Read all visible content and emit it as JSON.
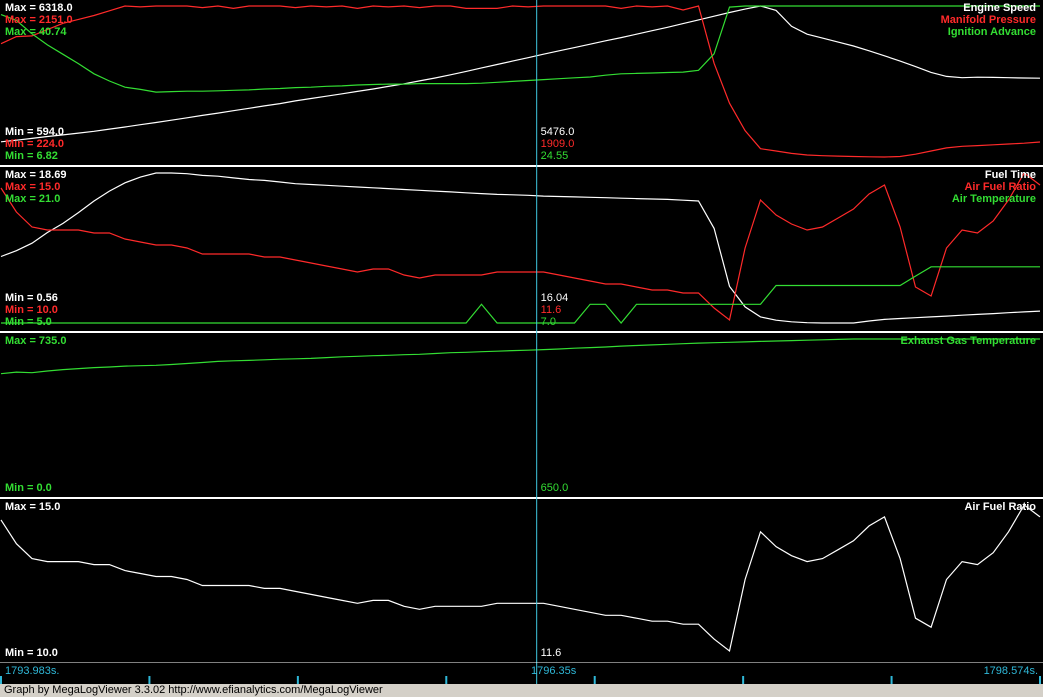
{
  "colors": {
    "white": "#ffffff",
    "red": "#ff2a2a",
    "green": "#33dd33",
    "cursor": "#3fc8e0",
    "timeaxis": "#2fb8d8"
  },
  "cursor_time": "1796.35s",
  "time_start_label": "1793.983s.",
  "time_end_label": "1798.574s.",
  "footer_text": "Graph by MegaLogViewer 3.3.02 http://www.efianalytics.com/MegaLogViewer",
  "panels": [
    {
      "traces": [
        {
          "name": "Engine Speed",
          "color": "white",
          "max_label": "Max = 6318.0",
          "min_label": "Min = 594.0",
          "cursor_value": "5476.0"
        },
        {
          "name": "Manifold Pressure",
          "color": "red",
          "max_label": "Max = 2151.0",
          "min_label": "Min = 224.0",
          "cursor_value": "1909.0"
        },
        {
          "name": "Ignition Advance",
          "color": "green",
          "max_label": "Max = 40.74",
          "min_label": "Min = 6.82",
          "cursor_value": "24.55"
        }
      ]
    },
    {
      "traces": [
        {
          "name": "Fuel Time",
          "color": "white",
          "max_label": "Max = 18.69",
          "min_label": "Min = 0.56",
          "cursor_value": "16.04"
        },
        {
          "name": "Air Fuel Ratio",
          "color": "red",
          "max_label": "Max = 15.0",
          "min_label": "Min = 10.0",
          "cursor_value": "11.6"
        },
        {
          "name": "Air Temperature",
          "color": "green",
          "max_label": "Max = 21.0",
          "min_label": "Min = 5.0",
          "cursor_value": "7.0"
        }
      ]
    },
    {
      "traces": [
        {
          "name": "Exhaust Gas Temperature",
          "color": "green",
          "max_label": "Max = 735.0",
          "min_label": "Min = 0.0",
          "cursor_value": "650.0"
        }
      ]
    },
    {
      "traces": [
        {
          "name": "Air Fuel Ratio",
          "color": "white",
          "max_label": "Max = 15.0",
          "min_label": "Min = 10.0",
          "cursor_value": "11.6"
        }
      ]
    }
  ],
  "chart_data": {
    "type": "line",
    "x_unit": "s",
    "x_range": [
      1793.983,
      1798.574
    ],
    "cursor_x": 1796.35,
    "x": [
      1793.983,
      1794.051,
      1794.12,
      1794.188,
      1794.257,
      1794.325,
      1794.394,
      1794.462,
      1794.531,
      1794.599,
      1794.668,
      1794.736,
      1794.805,
      1794.873,
      1794.942,
      1795.01,
      1795.079,
      1795.147,
      1795.216,
      1795.284,
      1795.353,
      1795.421,
      1795.49,
      1795.558,
      1795.627,
      1795.695,
      1795.764,
      1795.832,
      1795.901,
      1795.969,
      1796.038,
      1796.106,
      1796.175,
      1796.243,
      1796.312,
      1796.38,
      1796.449,
      1796.517,
      1796.586,
      1796.654,
      1796.723,
      1796.791,
      1796.86,
      1796.928,
      1796.997,
      1797.065,
      1797.134,
      1797.202,
      1797.271,
      1797.339,
      1797.408,
      1797.476,
      1797.545,
      1797.613,
      1797.682,
      1797.75,
      1797.819,
      1797.887,
      1797.956,
      1798.024,
      1798.093,
      1798.161,
      1798.23,
      1798.298,
      1798.367,
      1798.435,
      1798.504,
      1798.574
    ],
    "series": [
      {
        "name": "Engine Speed",
        "panel": 0,
        "range": [
          594.0,
          6318.0
        ],
        "values": [
          1170,
          1230,
          1300,
          1370,
          1430,
          1500,
          1570,
          1650,
          1730,
          1820,
          1900,
          1990,
          2080,
          2170,
          2260,
          2350,
          2440,
          2530,
          2620,
          2720,
          2810,
          2900,
          2990,
          3080,
          3170,
          3270,
          3370,
          3480,
          3590,
          3710,
          3840,
          3970,
          4100,
          4230,
          4360,
          4490,
          4620,
          4740,
          4870,
          5000,
          5120,
          5250,
          5380,
          5510,
          5650,
          5790,
          5930,
          6070,
          6200,
          6318,
          6150,
          5550,
          5250,
          5100,
          4950,
          4800,
          4620,
          4430,
          4230,
          4020,
          3800,
          3650,
          3600,
          3620,
          3610,
          3600,
          3590,
          3580
        ]
      },
      {
        "name": "Manifold Pressure",
        "panel": 0,
        "range": [
          224.0,
          2151.0
        ],
        "values": [
          1670,
          1760,
          1770,
          1850,
          1930,
          1980,
          2030,
          2090,
          2151,
          2140,
          2151,
          2151,
          2151,
          2130,
          2151,
          2120,
          2151,
          2151,
          2151,
          2130,
          2151,
          2140,
          2151,
          2120,
          2151,
          2140,
          2151,
          2130,
          2151,
          2151,
          2120,
          2120,
          2120,
          2151,
          2140,
          2151,
          2151,
          2151,
          2151,
          2151,
          2120,
          2151,
          2140,
          2151,
          2100,
          2151,
          1420,
          910,
          560,
          330,
          300,
          270,
          250,
          240,
          235,
          230,
          226,
          224,
          230,
          260,
          300,
          340,
          360,
          370,
          380,
          390,
          400,
          415
        ]
      },
      {
        "name": "Ignition Advance",
        "panel": 0,
        "range": [
          6.82,
          40.74
        ],
        "values": [
          38.8,
          37.5,
          34.5,
          32.0,
          29.9,
          27.8,
          25.5,
          23.9,
          22.5,
          22.0,
          21.4,
          21.5,
          21.6,
          21.6,
          21.7,
          21.8,
          21.9,
          22.1,
          22.2,
          22.4,
          22.5,
          22.7,
          22.8,
          23.0,
          23.1,
          23.2,
          23.2,
          23.3,
          23.3,
          23.3,
          23.3,
          23.4,
          23.6,
          23.8,
          24.0,
          24.2,
          24.4,
          24.6,
          24.8,
          25.2,
          25.5,
          25.6,
          25.7,
          25.8,
          25.9,
          26.3,
          30.0,
          40.5,
          40.74,
          40.74,
          40.74,
          40.74,
          40.74,
          40.74,
          40.74,
          40.74,
          40.74,
          40.74,
          40.74,
          40.74,
          40.74,
          40.74,
          40.74,
          40.74,
          40.74,
          40.74,
          40.74,
          40.74
        ]
      },
      {
        "name": "Fuel Time",
        "panel": 1,
        "range": [
          0.56,
          18.69
        ],
        "values": [
          8.6,
          9.3,
          10.2,
          11.5,
          12.6,
          13.9,
          15.3,
          16.5,
          17.5,
          18.2,
          18.69,
          18.69,
          18.6,
          18.4,
          18.3,
          18.1,
          17.9,
          17.8,
          17.6,
          17.4,
          17.3,
          17.2,
          17.1,
          17.0,
          16.9,
          16.8,
          16.7,
          16.6,
          16.5,
          16.4,
          16.3,
          16.2,
          16.1,
          16.05,
          16.0,
          15.9,
          15.85,
          15.8,
          15.75,
          15.7,
          15.65,
          15.6,
          15.55,
          15.5,
          15.4,
          15.3,
          12.0,
          5.0,
          2.5,
          1.3,
          0.9,
          0.7,
          0.6,
          0.56,
          0.56,
          0.56,
          0.8,
          1.0,
          1.1,
          1.2,
          1.3,
          1.4,
          1.5,
          1.6,
          1.7,
          1.8,
          1.9,
          2.0
        ]
      },
      {
        "name": "Air Fuel Ratio (top)",
        "panel": 1,
        "range": [
          10.0,
          15.0
        ],
        "values": [
          14.5,
          13.7,
          13.2,
          13.1,
          13.1,
          13.1,
          13.0,
          13.0,
          12.8,
          12.7,
          12.6,
          12.6,
          12.5,
          12.3,
          12.3,
          12.3,
          12.3,
          12.2,
          12.2,
          12.1,
          12.0,
          11.9,
          11.8,
          11.7,
          11.8,
          11.8,
          11.6,
          11.5,
          11.6,
          11.6,
          11.6,
          11.6,
          11.7,
          11.7,
          11.7,
          11.7,
          11.6,
          11.5,
          11.4,
          11.3,
          11.3,
          11.2,
          11.1,
          11.1,
          11.0,
          11.0,
          10.5,
          10.1,
          12.5,
          14.1,
          13.6,
          13.3,
          13.1,
          13.2,
          13.5,
          13.8,
          14.3,
          14.6,
          13.2,
          11.2,
          10.9,
          12.5,
          13.1,
          13.0,
          13.4,
          14.1,
          15.0,
          14.6
        ]
      },
      {
        "name": "Air Temperature",
        "panel": 1,
        "range": [
          5.0,
          21.0
        ],
        "values": [
          5.0,
          5.0,
          5.0,
          5.0,
          5.0,
          5.0,
          5.0,
          5.0,
          5.0,
          5.0,
          5.0,
          5.0,
          5.0,
          5.0,
          5.0,
          5.0,
          5.0,
          5.0,
          5.0,
          5.0,
          5.0,
          5.0,
          5.0,
          5.0,
          5.0,
          5.0,
          5.0,
          5.0,
          5.0,
          5.0,
          5.0,
          7.0,
          5.0,
          5.0,
          5.0,
          5.0,
          5.0,
          5.0,
          7.0,
          7.0,
          5.0,
          7.0,
          7.0,
          7.0,
          7.0,
          7.0,
          7.0,
          7.0,
          7.0,
          7.0,
          9.0,
          9.0,
          9.0,
          9.0,
          9.0,
          9.0,
          9.0,
          9.0,
          9.0,
          10.0,
          11.0,
          11.0,
          11.0,
          11.0,
          11.0,
          11.0,
          11.0,
          11.0
        ]
      },
      {
        "name": "Exhaust Gas Temperature",
        "panel": 2,
        "range": [
          0.0,
          735.0
        ],
        "values": [
          565,
          573,
          570,
          578,
          585,
          590,
          595,
          598,
          602,
          604,
          606,
          610,
          615,
          620,
          625,
          628,
          630,
          633,
          636,
          638,
          640,
          644,
          648,
          650,
          653,
          655,
          658,
          660,
          664,
          668,
          670,
          673,
          675,
          678,
          680,
          683,
          686,
          690,
          693,
          696,
          700,
          703,
          706,
          709,
          712,
          715,
          717,
          719,
          721,
          723,
          725,
          727,
          729,
          731,
          733,
          735,
          735,
          735,
          735,
          735,
          735,
          735,
          735,
          735,
          735,
          735,
          735,
          735
        ]
      },
      {
        "name": "Air Fuel Ratio",
        "panel": 3,
        "range": [
          10.0,
          15.0
        ],
        "values": [
          14.5,
          13.7,
          13.2,
          13.1,
          13.1,
          13.1,
          13.0,
          13.0,
          12.8,
          12.7,
          12.6,
          12.6,
          12.5,
          12.3,
          12.3,
          12.3,
          12.3,
          12.2,
          12.2,
          12.1,
          12.0,
          11.9,
          11.8,
          11.7,
          11.8,
          11.8,
          11.6,
          11.5,
          11.6,
          11.6,
          11.6,
          11.6,
          11.7,
          11.7,
          11.7,
          11.7,
          11.6,
          11.5,
          11.4,
          11.3,
          11.3,
          11.2,
          11.1,
          11.1,
          11.0,
          11.0,
          10.5,
          10.1,
          12.5,
          14.1,
          13.6,
          13.3,
          13.1,
          13.2,
          13.5,
          13.8,
          14.3,
          14.6,
          13.2,
          11.2,
          10.9,
          12.5,
          13.1,
          13.0,
          13.4,
          14.1,
          15.0,
          14.6
        ]
      }
    ]
  }
}
